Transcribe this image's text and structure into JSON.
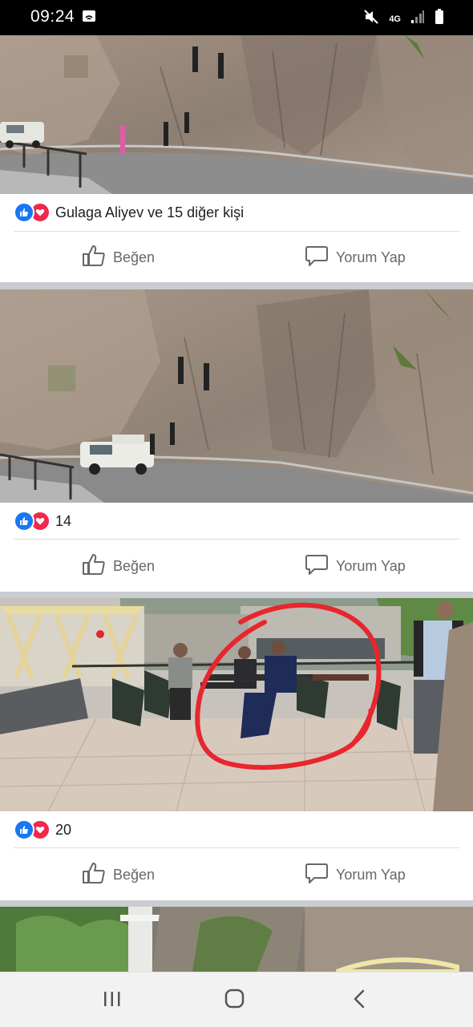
{
  "status_bar": {
    "time": "09:24",
    "network": "4G",
    "icons": [
      "screen-mirror-icon",
      "mute-icon",
      "signal-icon",
      "battery-icon"
    ]
  },
  "posts": [
    {
      "photo": "cliff-road-climbers",
      "reactions": [
        "like-icon",
        "love-icon"
      ],
      "reaction_text": "Gulaga Aliyev ve 15 diğer kişi",
      "like_label": "Beğen",
      "comment_label": "Yorum Yap"
    },
    {
      "photo": "cliff-road-climbers-car",
      "reactions": [
        "like-icon",
        "love-icon"
      ],
      "reaction_text": "14",
      "like_label": "Beğen",
      "comment_label": "Yorum Yap"
    },
    {
      "photo": "terrace-cafe-circled",
      "reactions": [
        "like-icon",
        "love-icon"
      ],
      "reaction_text": "20",
      "like_label": "Beğen",
      "comment_label": "Yorum Yap"
    }
  ],
  "colors": {
    "facebook_blue": "#1877f2",
    "love_red": "#f0284a",
    "annotation_circle": "#e8262d",
    "action_gray": "#65676b"
  },
  "nav_bar": {
    "buttons": [
      "recent-apps-icon",
      "home-icon",
      "back-icon"
    ]
  }
}
